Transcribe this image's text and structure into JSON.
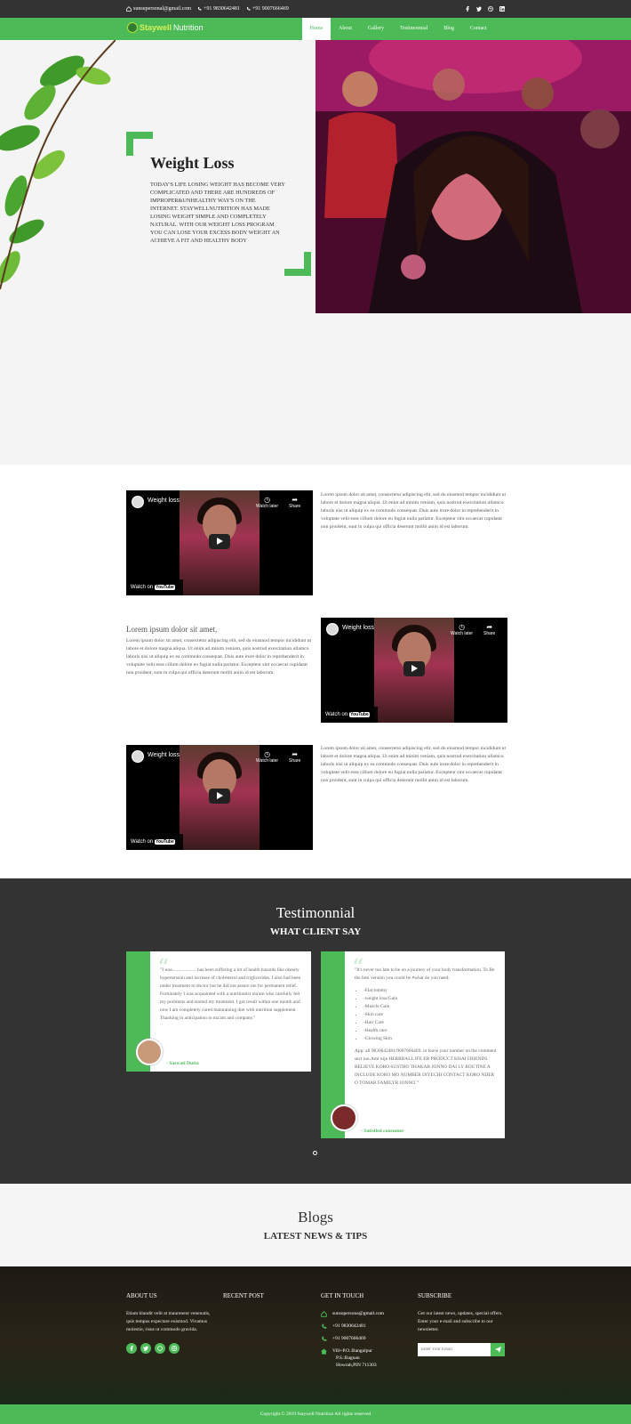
{
  "topbar": {
    "email": "sunsupersonal@gmail.com",
    "phone1": "+91 9830642481",
    "phone2": "+91 9007666469",
    "social_icons": [
      "facebook-icon",
      "twitter-icon",
      "dribbble-icon",
      "linkedin-icon"
    ]
  },
  "brand": {
    "part1": "Staywell",
    "part2": "Nutrition"
  },
  "nav": {
    "items": [
      "Home",
      "About",
      "Gallery",
      "Testimonnial",
      "Blog",
      "Contact"
    ],
    "active": "Home"
  },
  "hero": {
    "title": "Weight Loss",
    "text": "TODAY'S LIFE LOSING WEIGHT HAS BECOME VERY COMPLICATED AND THERE ARE HUNDREDS OF IMPROPER&UNHEALTHY WAY'S ON THE INTERNET. STAYWELLNUTRITION HAS MADE LOSING WEIGHT SIMPLE AND COMPLETELY NATURAL. WITH OUR WEIGHT LOSS PROGRAM YOU CAN LOSE YOUR EXCESS BODY WEIGHT AN ACHIEVE A FIT AND HEALTHY BODY"
  },
  "video": {
    "title": "Weight loss",
    "watch_later": "Watch later",
    "share": "Share",
    "watch_on": "Watch on",
    "youtube": "YouTube"
  },
  "lorem": "Lorem ipsum dolor sit amet, consectetur adipiscing elit, sed do eiusmod tempor incididunt ut labore et dolore magna aliqua. Ut enim ad minim veniam, quis nostrud exercitation ullamco laboris nisi ut aliquip ex ea commodo consequat. Duis aute irure dolor in reprehenderit in voluptate velit esse cillum dolore eu fugiat nulla pariatur. Excepteur sint occaecat cupidatat non proident, sunt in culpa qui officia deserunt mollit anim id est laborum.",
  "mid_heading": "Lorem ipsum dolor sit amet,",
  "testimonials": {
    "title": "Testimonnial",
    "subtitle": "WHAT CLIENT SAY",
    "items": [
      {
        "text": "\"I was.................... has been suffering a lot of health hazards like obesity hypertension and increase of cholesterol and triglicerides. I also had been under treatment to doctor but he did not assure me for permanent relief. Fortunately I was acquainted with a nutritionist ma'am who carefully felt my problems and started my treatment. I got result within one month and now I am completely cured maintaining diet with nutrition supplement. Thanking in anticipation to ma'am and company.\"",
        "author": "- Saswati Dutta"
      },
      {
        "intro": "\"It's never too late to be on a journey of your body transformation. To Be the best version you could be #what do you need:",
        "list": [
          "-Flat tummy",
          "-weight loss/Gain",
          "-Muscle Gain",
          "-Skin care",
          "-Hair Care",
          "-Health care",
          "-Glowing Skin"
        ],
        "outro": "App: all 9830642481/9007666469. or leave your number on the comment sect ion.Ami nije HERRBALL IFE ER PRODUCT KHAI FRIENDS BELIEVE KORO SUSTHO THAKAR JONNO DAI LY ROUTINE A INCLUDE KORO MO NUMBER DIYECHI CONTACT KORO NIJER O TOMAR FAMILYR JONNO.\"",
        "author": "- Satisfied consumer"
      }
    ]
  },
  "blogs": {
    "title": "Blogs",
    "subtitle": "LATEST NEWS & TIPS"
  },
  "footer": {
    "about": {
      "heading": "ABOUT US",
      "text": "Etiam blandit velit at maurenent venenatis, quis tempus expectare euismod. Vivamus molestie, risus ut commodo gravida."
    },
    "recent": {
      "heading": "RECENT POST"
    },
    "contact": {
      "heading": "GET IN TOUCH",
      "email": "sunsupersona@gmail.com",
      "phone1": "+91 9830642481",
      "phone2": "+91 9007666469",
      "address": [
        "Vill+P.O.:Bangalpur",
        "P.S.:Bagnan",
        "Howrah,PIN 711303"
      ]
    },
    "subscribe": {
      "heading": "SUBSCRIBE",
      "text": "Get our latest news, updates, special offers. Enter your e-mail and subscribe to our newsletter.",
      "placeholder": "Enter Your Email"
    },
    "copyright": "Copyright © 2019 Staywell Nutrition All rights reserved"
  },
  "colors": {
    "accent": "#4cba56",
    "dark": "#333333",
    "light_bg": "#f4f4f4"
  }
}
